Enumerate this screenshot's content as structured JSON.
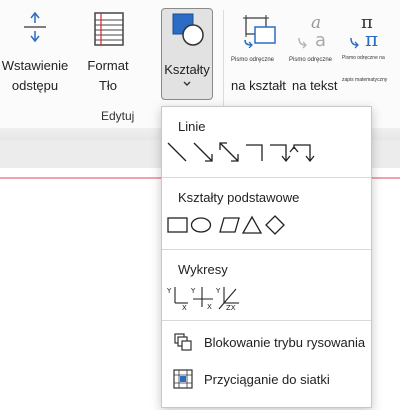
{
  "ribbon": {
    "buttons": {
      "spacing": {
        "line1": "Wstawienie",
        "line2": "odstępu"
      },
      "format": {
        "line1": "Format",
        "line2": "Tło"
      },
      "shapes": {
        "label": "Kształty"
      },
      "ink_to_shape": {
        "label": "Pismo odręczne",
        "sub": "na kształt"
      },
      "ink_to_text": {
        "label": "Pismo odręczne",
        "sub": "na tekst"
      },
      "ink_to_math": {
        "label": "Pismo odręczne na",
        "sub": "zapis matematyczny"
      }
    },
    "group_label": "Edytuj"
  },
  "dropdown": {
    "lines_header": "Linie",
    "basic_shapes_header": "Kształty podstawowe",
    "charts_header": "Wykresy",
    "lock_label": "Blokowanie trybu rysowania",
    "snap_label": "Przyciąganie do siatki"
  },
  "colors": {
    "accent_blue": "#2b6cc4",
    "selected_bg": "#e2e2e2",
    "margin_line": "#f0a3ad"
  }
}
